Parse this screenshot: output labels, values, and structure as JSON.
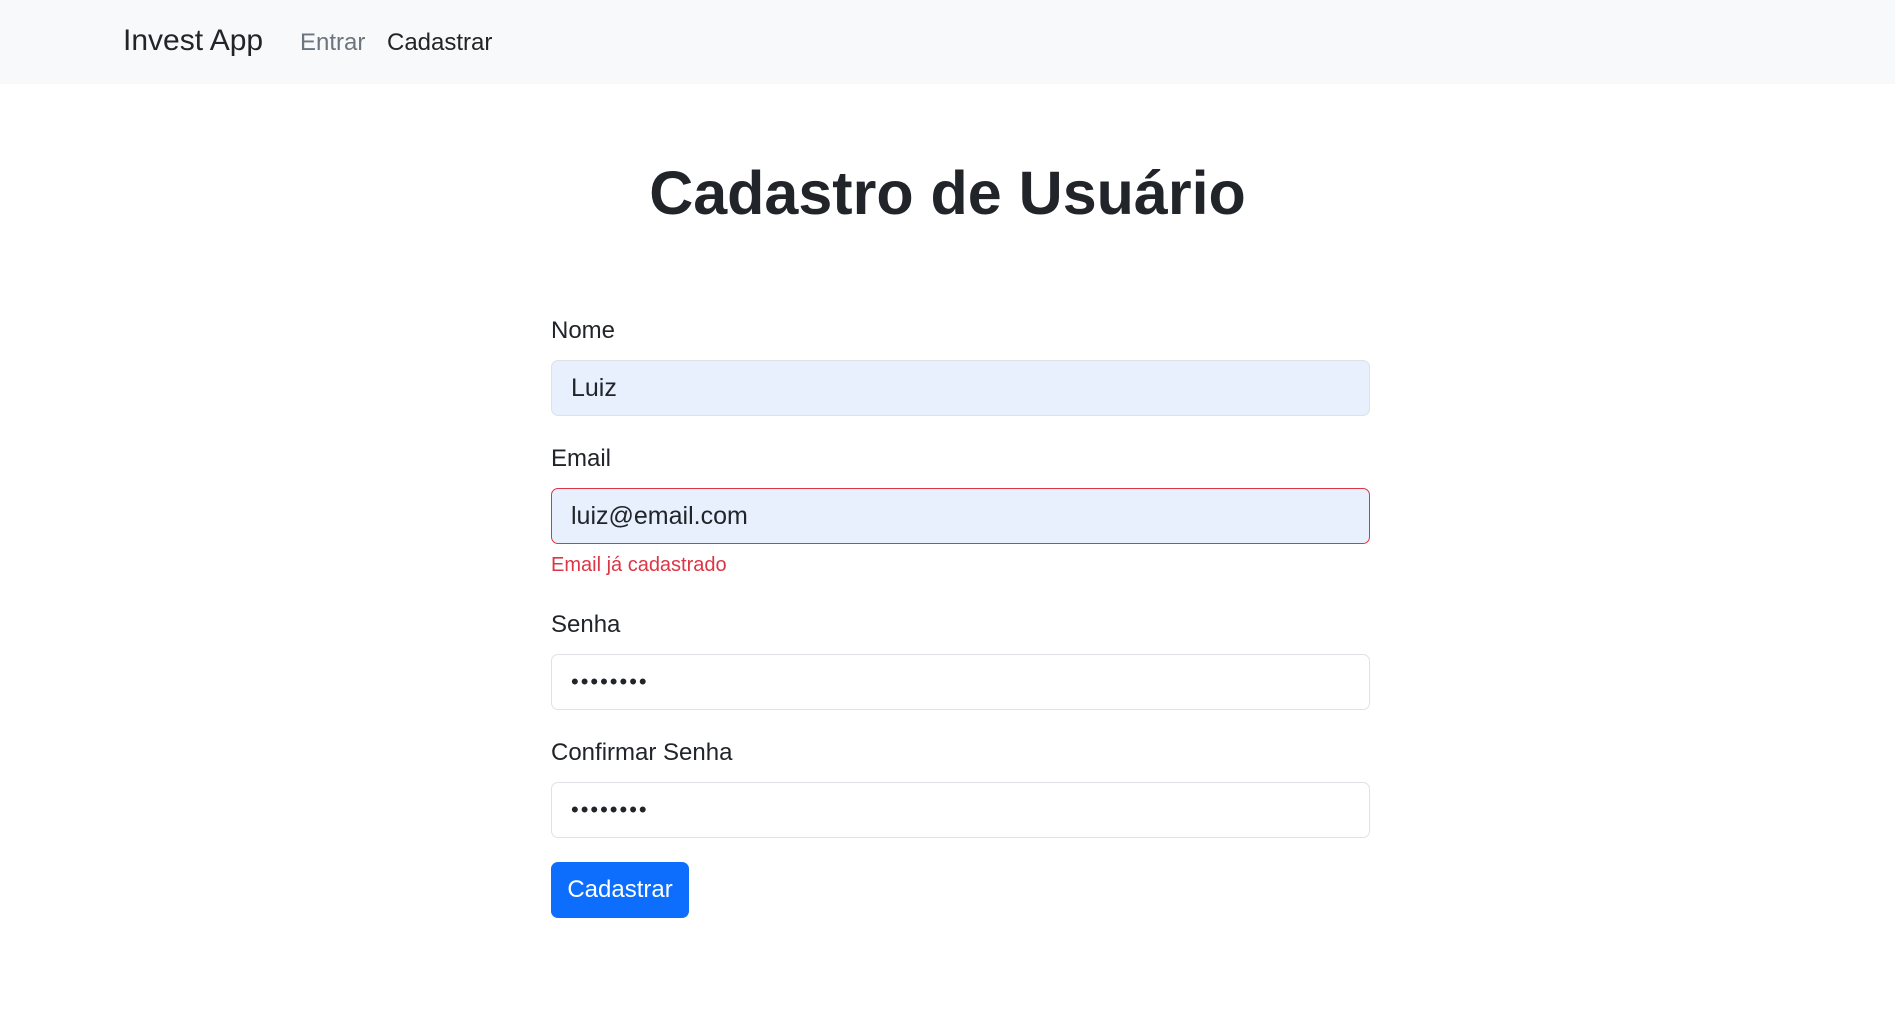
{
  "navbar": {
    "brand": "Invest App",
    "links": [
      {
        "label": "Entrar"
      },
      {
        "label": "Cadastrar"
      }
    ]
  },
  "page": {
    "title": "Cadastro de Usuário"
  },
  "form": {
    "name": {
      "label": "Nome",
      "value": "Luiz"
    },
    "email": {
      "label": "Email",
      "value": "luiz@email.com",
      "error": "Email já cadastrado"
    },
    "password": {
      "label": "Senha",
      "value": "••••••••"
    },
    "confirm_password": {
      "label": "Confirmar Senha",
      "value": "••••••••"
    },
    "submit_label": "Cadastrar"
  },
  "colors": {
    "navbar_bg": "#f8f9fa",
    "primary": "#0d6efd",
    "danger": "#dc3545",
    "autofill_bg": "#e8f0fe"
  }
}
